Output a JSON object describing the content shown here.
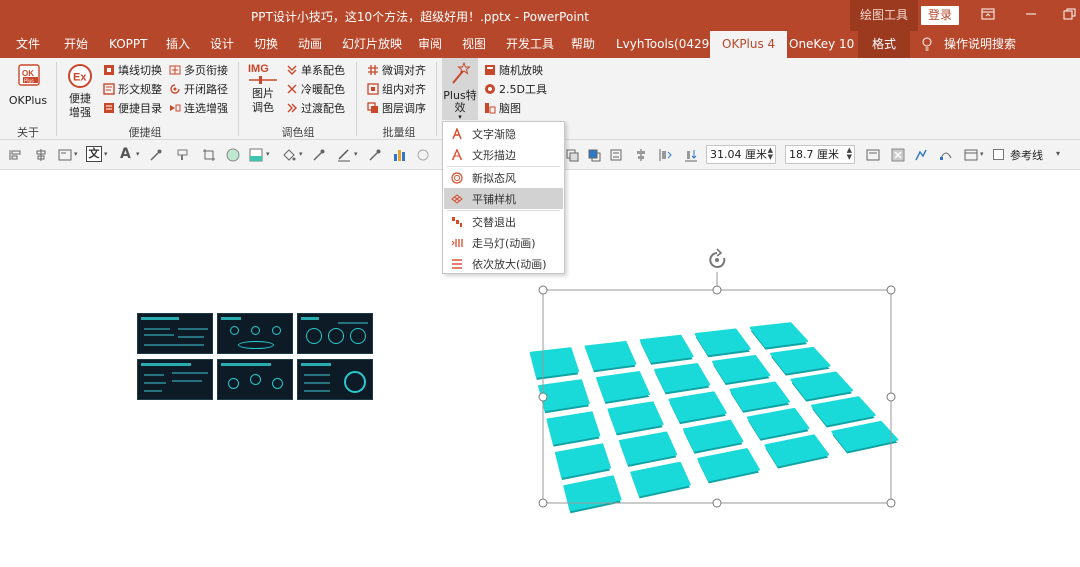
{
  "window": {
    "title": "PPT设计小技巧，这10个方法，超级好用！.pptx - PowerPoint",
    "context_tab_header": "绘图工具",
    "login_label": "登录"
  },
  "tabs": {
    "file": "文件",
    "home": "开始",
    "koppt": "KOPPT",
    "insert": "插入",
    "design": "设计",
    "transitions": "切换",
    "animations": "动画",
    "slideshow": "幻灯片放映",
    "review": "审阅",
    "view": "视图",
    "developer": "开发工具",
    "help": "帮助",
    "lvyhtools": "LvyhTools(0429)",
    "okplus": "OKPlus 4",
    "onekey": "OneKey 10",
    "format": "格式",
    "tellme": "操作说明搜索"
  },
  "ribbon": {
    "okplus_label": "OKPlus",
    "about_group": "关于",
    "enhance_label": "便捷增强",
    "shortcut_group": "便捷组",
    "fill_line_switch": "填线切换",
    "shape_text_spec": "形文规整",
    "shortcut_directory": "便捷目录",
    "multi_page_join": "多页衔接",
    "open_close_path": "开闭路径",
    "chain_select_enhance": "连选增强",
    "image_color": "图片调色",
    "img_badge": "IMG",
    "single_color": "单系配色",
    "warm_cold_color": "冷暖配色",
    "transition_color": "过渡配色",
    "color_group": "调色组",
    "fine_align": "微调对齐",
    "group_align": "组内对齐",
    "layer_order": "图层调序",
    "batch_group": "批量组",
    "plus_effects": "Plus特效",
    "random_play": "随机放映",
    "tool_25d": "2.5D工具",
    "brain_map": "脑图"
  },
  "format_bar": {
    "width_value": "31.04 厘米",
    "height_value": "18.7 厘米",
    "ref_line_label": "参考线"
  },
  "dropdown": {
    "items": [
      {
        "label": "文字渐隐",
        "icon": "text-fade-icon"
      },
      {
        "label": "文形描边",
        "icon": "text-outline-icon"
      },
      {
        "label": "新拟态风",
        "icon": "neumorphism-icon"
      },
      {
        "label": "平铺样机",
        "icon": "tile-mockup-icon"
      },
      {
        "label": "交替退出",
        "icon": "alternate-exit-icon"
      },
      {
        "label": "走马灯(动画)",
        "icon": "marquee-icon"
      },
      {
        "label": "依次放大(动画)",
        "icon": "zoom-sequence-icon"
      }
    ],
    "highlighted": "平铺样机"
  },
  "colors": {
    "accent": "#b7472a",
    "tile": "#1ad9d9",
    "tile_shadow": "#0fa3a3",
    "thumb_bg": "#0d1b26"
  }
}
